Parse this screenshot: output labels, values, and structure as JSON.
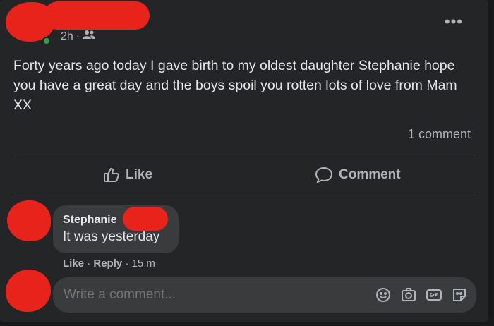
{
  "post": {
    "timestamp": "2h",
    "separator": "·",
    "audience_icon": "friends-icon",
    "more_icon": "•••",
    "text": "Forty years ago today I gave birth to my oldest daughter Stephanie hope you have a great day and the boys spoil you rotten lots of love from Mam XX",
    "comment_count": "1 comment"
  },
  "actions": {
    "like_label": "Like",
    "comment_label": "Comment"
  },
  "comment": {
    "author": "Stephanie",
    "text": "It was yesterday",
    "like_label": "Like",
    "reply_label": "Reply",
    "sep": "·",
    "time": "15 m"
  },
  "composer": {
    "placeholder": "Write a comment...",
    "icons": [
      "emoji-icon",
      "camera-icon",
      "gif-icon",
      "sticker-icon"
    ]
  },
  "colors": {
    "card_bg": "#242526",
    "bubble_bg": "#3a3b3c",
    "text_primary": "#e4e6eb",
    "text_secondary": "#b0b3b8",
    "redaction": "#e8231b",
    "online": "#31a24c"
  }
}
